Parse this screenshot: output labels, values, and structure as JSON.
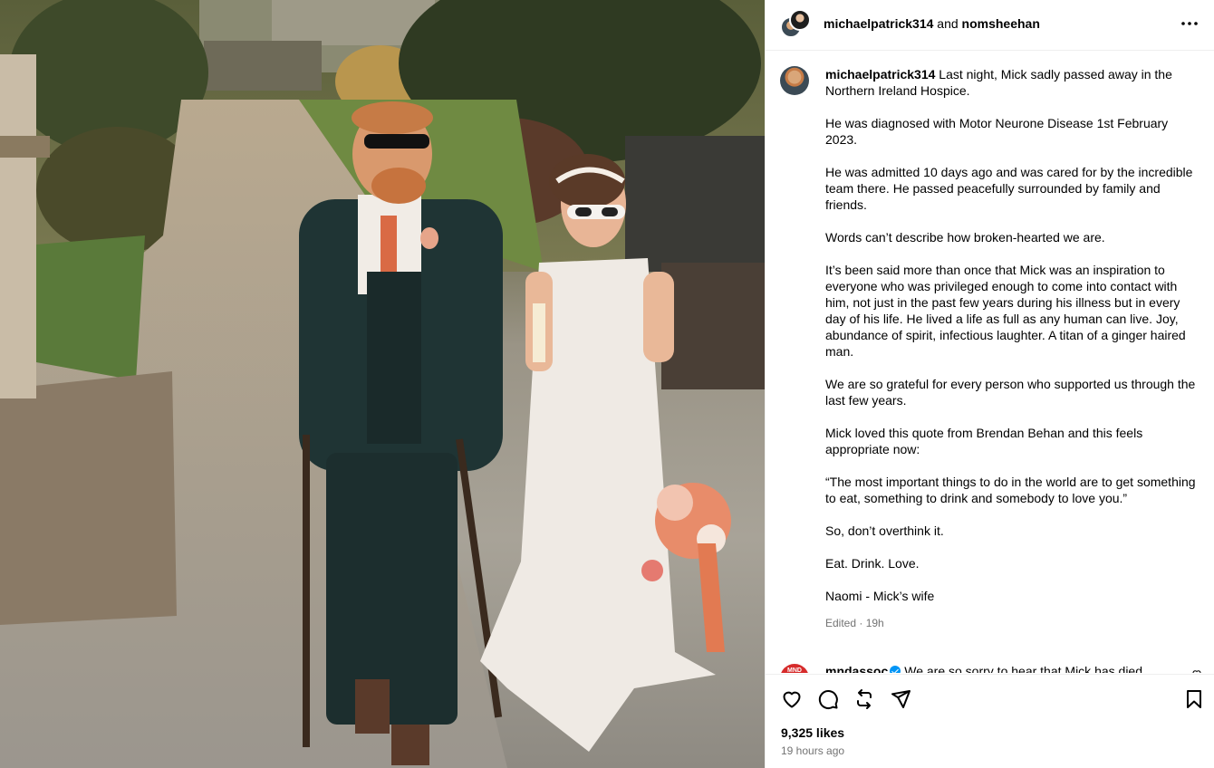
{
  "media": {
    "description_icon": "photo"
  },
  "header": {
    "user1": "michaelpatrick314",
    "joiner": "and",
    "user2": "nomsheehan"
  },
  "caption": {
    "username": "michaelpatrick314",
    "paragraphs": [
      "Last night, Mick sadly passed away in the Northern Ireland Hospice.",
      "He was diagnosed with Motor Neurone Disease 1st February 2023.",
      "He was admitted 10 days ago and was cared for by the incredible team there. He passed peacefully surrounded by family and friends.",
      "Words can’t describe how broken-hearted we are.",
      "It’s been said more than once that Mick was an inspiration to everyone who was privileged enough to come into contact with him, not just in the past few years during his illness but in every day of his life. He lived a life as full as any human can live. Joy, abundance of spirit, infectious laughter. A titan of a ginger haired man.",
      "We are so grateful for every person who supported us through the last few years.",
      "Mick loved this quote from Brendan Behan and this feels appropriate now:",
      "“The most important things to do in the world are to get something to eat, something to drink and somebody to love you.”",
      "So, don’t overthink it.",
      "Eat. Drink. Love.",
      "Naomi - Mick’s wife"
    ],
    "meta": "Edited · 19h"
  },
  "comment": {
    "avatar_text": "MND",
    "username": "mndassoc",
    "text": "We are so sorry to hear that Mick has died."
  },
  "actions": {
    "likes": "9,325 likes",
    "time": "19 hours ago"
  }
}
